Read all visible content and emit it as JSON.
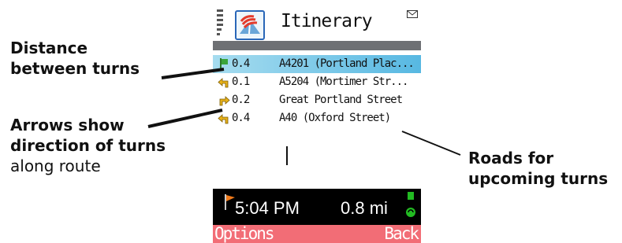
{
  "callouts": {
    "distance": {
      "line1": "Distance",
      "line2": "between turns"
    },
    "arrows": {
      "line1": "Arrows show",
      "line2": "direction of turns",
      "line3": "along route"
    },
    "roads": {
      "line1": "Roads for",
      "line2": "upcoming turns"
    }
  },
  "app": {
    "title": "Itinerary",
    "icon": "app-map-icon"
  },
  "itinerary": [
    {
      "icon": "start-flag-icon",
      "distance": "0.4",
      "road": "A4201 (Portland Plac...",
      "selected": true
    },
    {
      "icon": "turn-left-arrow-icon",
      "distance": "0.1",
      "road": "A5204 (Mortimer Str...",
      "selected": false
    },
    {
      "icon": "turn-right-arrow-icon",
      "distance": "0.2",
      "road": "Great Portland Street",
      "selected": false
    },
    {
      "icon": "turn-left-arrow-icon",
      "distance": "0.4",
      "road": "A40 (Oxford Street)",
      "selected": false
    }
  ],
  "status": {
    "eta": "5:04 PM",
    "remaining": "0.8 mi"
  },
  "softkeys": {
    "left": "Options",
    "right": "Back"
  },
  "colors": {
    "selection": "#57b8e2",
    "softkey_bar": "#f26d76",
    "status_bar": "#000000",
    "turn_arrow": "#e8b21a"
  }
}
